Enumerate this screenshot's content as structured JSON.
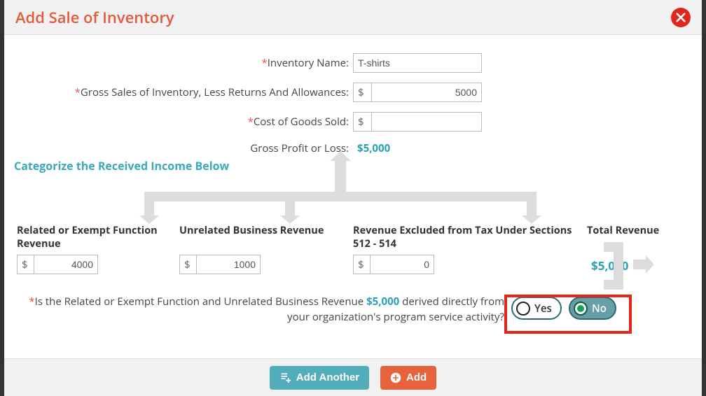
{
  "header": {
    "title": "Add Sale of Inventory"
  },
  "form": {
    "inventory_name_label": "Inventory Name:",
    "inventory_name_value": "T-shirts",
    "gross_sales_label": "Gross Sales of Inventory, Less Returns And Allowances:",
    "gross_sales_value": "5000",
    "cogs_label": "Cost of Goods Sold:",
    "cogs_value": "",
    "gross_profit_label": "Gross Profit or Loss:",
    "gross_profit_value": "$5,000",
    "currency": "$"
  },
  "categorize_title": "Categorize the Received Income Below",
  "columns": {
    "related": {
      "heading": "Related or Exempt Function Revenue",
      "value": "4000"
    },
    "unrelated": {
      "heading": "Unrelated Business Revenue",
      "value": "1000"
    },
    "excluded": {
      "heading": "Revenue Excluded from Tax Under Sections 512 - 514",
      "value": "0"
    },
    "total": {
      "heading": "Total Revenue",
      "value": "$5,000"
    }
  },
  "question": {
    "prefix": "Is the Related or Exempt Function and Unrelated Business Revenue ",
    "amount": "$5,000",
    "suffix": " derived directly from your organization's program service activity?",
    "yes_label": "Yes",
    "no_label": "No",
    "selected": "No"
  },
  "footer": {
    "add_another_label": "Add Another",
    "add_label": "Add"
  }
}
